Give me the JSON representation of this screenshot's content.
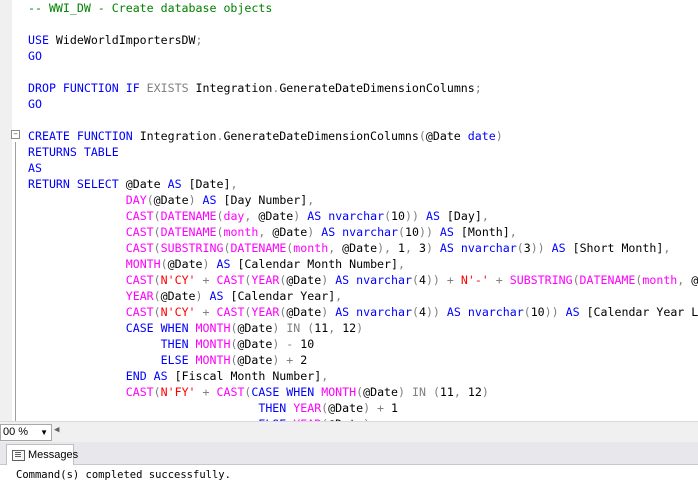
{
  "editor": {
    "lines": [
      {
        "parts": [
          {
            "t": "-- WWI_DW - Create database objects",
            "c": "cm"
          }
        ]
      },
      {
        "parts": []
      },
      {
        "parts": [
          {
            "t": "USE ",
            "c": "kw"
          },
          {
            "t": "WideWorldImportersDW",
            "c": "var"
          },
          {
            "t": ";",
            "c": "gray"
          }
        ]
      },
      {
        "parts": [
          {
            "t": "GO",
            "c": "kw"
          }
        ]
      },
      {
        "parts": []
      },
      {
        "parts": [
          {
            "t": "DROP FUNCTION IF ",
            "c": "kw"
          },
          {
            "t": "EXISTS ",
            "c": "gray"
          },
          {
            "t": "Integration",
            "c": "var"
          },
          {
            "t": ".",
            "c": "gray"
          },
          {
            "t": "GenerateDateDimensionColumns",
            "c": "var"
          },
          {
            "t": ";",
            "c": "gray"
          }
        ]
      },
      {
        "parts": [
          {
            "t": "GO",
            "c": "kw"
          }
        ]
      },
      {
        "parts": []
      },
      {
        "parts": [
          {
            "t": "CREATE FUNCTION ",
            "c": "kw"
          },
          {
            "t": "Integration",
            "c": "var"
          },
          {
            "t": ".",
            "c": "gray"
          },
          {
            "t": "GenerateDateDimensionColumns",
            "c": "var"
          },
          {
            "t": "(",
            "c": "gray"
          },
          {
            "t": "@Date ",
            "c": "var"
          },
          {
            "t": "date",
            "c": "kw"
          },
          {
            "t": ")",
            "c": "gray"
          }
        ]
      },
      {
        "parts": [
          {
            "t": "RETURNS TABLE",
            "c": "kw"
          }
        ]
      },
      {
        "parts": [
          {
            "t": "AS",
            "c": "kw"
          }
        ]
      },
      {
        "parts": [
          {
            "t": "RETURN SELECT ",
            "c": "kw"
          },
          {
            "t": "@Date ",
            "c": "var"
          },
          {
            "t": "AS ",
            "c": "kw"
          },
          {
            "t": "[Date]",
            "c": "var"
          },
          {
            "t": ",",
            "c": "gray"
          }
        ]
      },
      {
        "indent": "              ",
        "parts": [
          {
            "t": "DAY",
            "c": "fn"
          },
          {
            "t": "(",
            "c": "gray"
          },
          {
            "t": "@Date",
            "c": "var"
          },
          {
            "t": ") ",
            "c": "gray"
          },
          {
            "t": "AS ",
            "c": "kw"
          },
          {
            "t": "[Day Number]",
            "c": "var"
          },
          {
            "t": ",",
            "c": "gray"
          }
        ]
      },
      {
        "indent": "              ",
        "parts": [
          {
            "t": "CAST",
            "c": "fn"
          },
          {
            "t": "(",
            "c": "gray"
          },
          {
            "t": "DATENAME",
            "c": "fn"
          },
          {
            "t": "(",
            "c": "gray"
          },
          {
            "t": "day",
            "c": "fn"
          },
          {
            "t": ", ",
            "c": "gray"
          },
          {
            "t": "@Date",
            "c": "var"
          },
          {
            "t": ") ",
            "c": "gray"
          },
          {
            "t": "AS ",
            "c": "kw"
          },
          {
            "t": "nvarchar",
            "c": "kw"
          },
          {
            "t": "(",
            "c": "gray"
          },
          {
            "t": "10",
            "c": "var"
          },
          {
            "t": ")) ",
            "c": "gray"
          },
          {
            "t": "AS ",
            "c": "kw"
          },
          {
            "t": "[Day]",
            "c": "var"
          },
          {
            "t": ",",
            "c": "gray"
          }
        ]
      },
      {
        "indent": "              ",
        "parts": [
          {
            "t": "CAST",
            "c": "fn"
          },
          {
            "t": "(",
            "c": "gray"
          },
          {
            "t": "DATENAME",
            "c": "fn"
          },
          {
            "t": "(",
            "c": "gray"
          },
          {
            "t": "month",
            "c": "fn"
          },
          {
            "t": ", ",
            "c": "gray"
          },
          {
            "t": "@Date",
            "c": "var"
          },
          {
            "t": ") ",
            "c": "gray"
          },
          {
            "t": "AS ",
            "c": "kw"
          },
          {
            "t": "nvarchar",
            "c": "kw"
          },
          {
            "t": "(",
            "c": "gray"
          },
          {
            "t": "10",
            "c": "var"
          },
          {
            "t": ")) ",
            "c": "gray"
          },
          {
            "t": "AS ",
            "c": "kw"
          },
          {
            "t": "[Month]",
            "c": "var"
          },
          {
            "t": ",",
            "c": "gray"
          }
        ]
      },
      {
        "indent": "              ",
        "parts": [
          {
            "t": "CAST",
            "c": "fn"
          },
          {
            "t": "(",
            "c": "gray"
          },
          {
            "t": "SUBSTRING",
            "c": "fn"
          },
          {
            "t": "(",
            "c": "gray"
          },
          {
            "t": "DATENAME",
            "c": "fn"
          },
          {
            "t": "(",
            "c": "gray"
          },
          {
            "t": "month",
            "c": "fn"
          },
          {
            "t": ", ",
            "c": "gray"
          },
          {
            "t": "@Date",
            "c": "var"
          },
          {
            "t": "), ",
            "c": "gray"
          },
          {
            "t": "1",
            "c": "var"
          },
          {
            "t": ", ",
            "c": "gray"
          },
          {
            "t": "3",
            "c": "var"
          },
          {
            "t": ") ",
            "c": "gray"
          },
          {
            "t": "AS ",
            "c": "kw"
          },
          {
            "t": "nvarchar",
            "c": "kw"
          },
          {
            "t": "(",
            "c": "gray"
          },
          {
            "t": "3",
            "c": "var"
          },
          {
            "t": ")) ",
            "c": "gray"
          },
          {
            "t": "AS ",
            "c": "kw"
          },
          {
            "t": "[Short Month]",
            "c": "var"
          },
          {
            "t": ",",
            "c": "gray"
          }
        ]
      },
      {
        "indent": "              ",
        "parts": [
          {
            "t": "MONTH",
            "c": "fn"
          },
          {
            "t": "(",
            "c": "gray"
          },
          {
            "t": "@Date",
            "c": "var"
          },
          {
            "t": ") ",
            "c": "gray"
          },
          {
            "t": "AS ",
            "c": "kw"
          },
          {
            "t": "[Calendar Month Number]",
            "c": "var"
          },
          {
            "t": ",",
            "c": "gray"
          }
        ]
      },
      {
        "indent": "              ",
        "parts": [
          {
            "t": "CAST",
            "c": "fn"
          },
          {
            "t": "(",
            "c": "gray"
          },
          {
            "t": "N'CY'",
            "c": "str"
          },
          {
            "t": " + ",
            "c": "gray"
          },
          {
            "t": "CAST",
            "c": "fn"
          },
          {
            "t": "(",
            "c": "gray"
          },
          {
            "t": "YEAR",
            "c": "fn"
          },
          {
            "t": "(",
            "c": "gray"
          },
          {
            "t": "@Date",
            "c": "var"
          },
          {
            "t": ") ",
            "c": "gray"
          },
          {
            "t": "AS ",
            "c": "kw"
          },
          {
            "t": "nvarchar",
            "c": "kw"
          },
          {
            "t": "(",
            "c": "gray"
          },
          {
            "t": "4",
            "c": "var"
          },
          {
            "t": ")) + ",
            "c": "gray"
          },
          {
            "t": "N'-'",
            "c": "str"
          },
          {
            "t": " + ",
            "c": "gray"
          },
          {
            "t": "SUBSTRING",
            "c": "fn"
          },
          {
            "t": "(",
            "c": "gray"
          },
          {
            "t": "DATENAME",
            "c": "fn"
          },
          {
            "t": "(",
            "c": "gray"
          },
          {
            "t": "month",
            "c": "fn"
          },
          {
            "t": ", ",
            "c": "gray"
          },
          {
            "t": "@",
            "c": "var"
          }
        ]
      },
      {
        "indent": "              ",
        "parts": [
          {
            "t": "YEAR",
            "c": "fn"
          },
          {
            "t": "(",
            "c": "gray"
          },
          {
            "t": "@Date",
            "c": "var"
          },
          {
            "t": ") ",
            "c": "gray"
          },
          {
            "t": "AS ",
            "c": "kw"
          },
          {
            "t": "[Calendar Year]",
            "c": "var"
          },
          {
            "t": ",",
            "c": "gray"
          }
        ]
      },
      {
        "indent": "              ",
        "parts": [
          {
            "t": "CAST",
            "c": "fn"
          },
          {
            "t": "(",
            "c": "gray"
          },
          {
            "t": "N'CY'",
            "c": "str"
          },
          {
            "t": " + ",
            "c": "gray"
          },
          {
            "t": "CAST",
            "c": "fn"
          },
          {
            "t": "(",
            "c": "gray"
          },
          {
            "t": "YEAR",
            "c": "fn"
          },
          {
            "t": "(",
            "c": "gray"
          },
          {
            "t": "@Date",
            "c": "var"
          },
          {
            "t": ") ",
            "c": "gray"
          },
          {
            "t": "AS ",
            "c": "kw"
          },
          {
            "t": "nvarchar",
            "c": "kw"
          },
          {
            "t": "(",
            "c": "gray"
          },
          {
            "t": "4",
            "c": "var"
          },
          {
            "t": ")) ",
            "c": "gray"
          },
          {
            "t": "AS ",
            "c": "kw"
          },
          {
            "t": "nvarchar",
            "c": "kw"
          },
          {
            "t": "(",
            "c": "gray"
          },
          {
            "t": "10",
            "c": "var"
          },
          {
            "t": ")) ",
            "c": "gray"
          },
          {
            "t": "AS ",
            "c": "kw"
          },
          {
            "t": "[Calendar Year L",
            "c": "var"
          }
        ]
      },
      {
        "indent": "              ",
        "parts": [
          {
            "t": "CASE WHEN ",
            "c": "kw"
          },
          {
            "t": "MONTH",
            "c": "fn"
          },
          {
            "t": "(",
            "c": "gray"
          },
          {
            "t": "@Date",
            "c": "var"
          },
          {
            "t": ") ",
            "c": "gray"
          },
          {
            "t": "IN ",
            "c": "gray"
          },
          {
            "t": "(",
            "c": "gray"
          },
          {
            "t": "11",
            "c": "var"
          },
          {
            "t": ", ",
            "c": "gray"
          },
          {
            "t": "12",
            "c": "var"
          },
          {
            "t": ")",
            "c": "gray"
          }
        ]
      },
      {
        "indent": "                   ",
        "parts": [
          {
            "t": "THEN ",
            "c": "kw"
          },
          {
            "t": "MONTH",
            "c": "fn"
          },
          {
            "t": "(",
            "c": "gray"
          },
          {
            "t": "@Date",
            "c": "var"
          },
          {
            "t": ") - ",
            "c": "gray"
          },
          {
            "t": "10",
            "c": "var"
          }
        ]
      },
      {
        "indent": "                   ",
        "parts": [
          {
            "t": "ELSE ",
            "c": "kw"
          },
          {
            "t": "MONTH",
            "c": "fn"
          },
          {
            "t": "(",
            "c": "gray"
          },
          {
            "t": "@Date",
            "c": "var"
          },
          {
            "t": ") + ",
            "c": "gray"
          },
          {
            "t": "2",
            "c": "var"
          }
        ]
      },
      {
        "indent": "              ",
        "parts": [
          {
            "t": "END ",
            "c": "kw"
          },
          {
            "t": "AS ",
            "c": "kw"
          },
          {
            "t": "[Fiscal Month Number]",
            "c": "var"
          },
          {
            "t": ",",
            "c": "gray"
          }
        ]
      },
      {
        "indent": "              ",
        "parts": [
          {
            "t": "CAST",
            "c": "fn"
          },
          {
            "t": "(",
            "c": "gray"
          },
          {
            "t": "N'FY'",
            "c": "str"
          },
          {
            "t": " + ",
            "c": "gray"
          },
          {
            "t": "CAST",
            "c": "fn"
          },
          {
            "t": "(",
            "c": "gray"
          },
          {
            "t": "CASE WHEN ",
            "c": "kw"
          },
          {
            "t": "MONTH",
            "c": "fn"
          },
          {
            "t": "(",
            "c": "gray"
          },
          {
            "t": "@Date",
            "c": "var"
          },
          {
            "t": ") ",
            "c": "gray"
          },
          {
            "t": "IN ",
            "c": "gray"
          },
          {
            "t": "(",
            "c": "gray"
          },
          {
            "t": "11",
            "c": "var"
          },
          {
            "t": ", ",
            "c": "gray"
          },
          {
            "t": "12",
            "c": "var"
          },
          {
            "t": ")",
            "c": "gray"
          }
        ]
      },
      {
        "indent": "                                 ",
        "parts": [
          {
            "t": "THEN ",
            "c": "kw"
          },
          {
            "t": "YEAR",
            "c": "fn"
          },
          {
            "t": "(",
            "c": "gray"
          },
          {
            "t": "@Date",
            "c": "var"
          },
          {
            "t": ") + ",
            "c": "gray"
          },
          {
            "t": "1",
            "c": "var"
          }
        ]
      },
      {
        "indent": "                                 ",
        "parts": [
          {
            "t": "ELSE ",
            "c": "kw"
          },
          {
            "t": "YEAR",
            "c": "fn"
          },
          {
            "t": "(",
            "c": "gray"
          },
          {
            "t": "@Date",
            "c": "var"
          },
          {
            "t": ")",
            "c": "gray"
          }
        ]
      }
    ]
  },
  "statusbar": {
    "zoom": "00 %"
  },
  "results": {
    "tab_label": "Messages",
    "message": "Command(s) completed successfully."
  }
}
